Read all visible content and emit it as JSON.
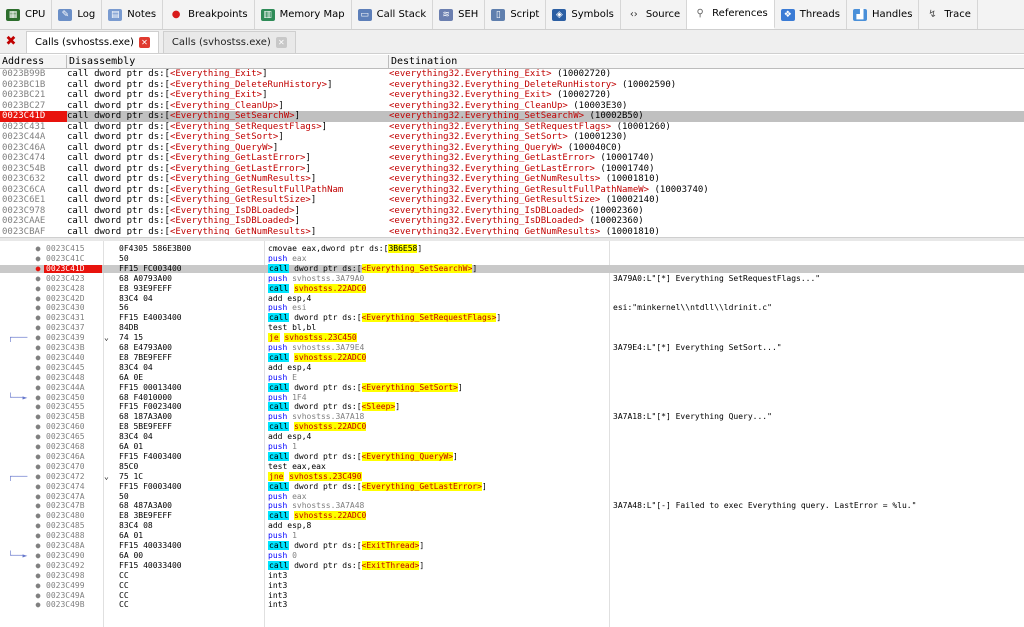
{
  "toolbar": {
    "tabs": [
      {
        "label": "CPU",
        "icon": "cpu-icon",
        "color": "#2d6e2d"
      },
      {
        "label": "Log",
        "icon": "log-icon",
        "color": "#6b8fc7"
      },
      {
        "label": "Notes",
        "icon": "notes-icon",
        "color": "#7a9bd0"
      },
      {
        "label": "Breakpoints",
        "icon": "breakpoint-icon",
        "color": "#d81b1b"
      },
      {
        "label": "Memory Map",
        "icon": "memory-map-icon",
        "color": "#2e8b57"
      },
      {
        "label": "Call Stack",
        "icon": "call-stack-icon",
        "color": "#5d7fb9"
      },
      {
        "label": "SEH",
        "icon": "seh-icon",
        "color": "#6b7fb0"
      },
      {
        "label": "Script",
        "icon": "script-icon",
        "color": "#5f7fae"
      },
      {
        "label": "Symbols",
        "icon": "symbols-icon",
        "color": "#2c5fa3"
      },
      {
        "label": "Source",
        "icon": "source-icon",
        "color": "#333333"
      },
      {
        "label": "References",
        "icon": "references-icon",
        "color": "#666666"
      },
      {
        "label": "Threads",
        "icon": "threads-icon",
        "color": "#3a7bd5"
      },
      {
        "label": "Handles",
        "icon": "handles-icon",
        "color": "#4a90d9"
      },
      {
        "label": "Trace",
        "icon": "trace-icon",
        "color": "#555555"
      }
    ]
  },
  "subtabs": [
    {
      "label": "Calls (svhostss.exe)",
      "active": true
    },
    {
      "label": "Calls (svhostss.exe)",
      "active": false
    }
  ],
  "references": {
    "headers": [
      "Address",
      "Disassembly",
      "Destination"
    ],
    "rows": [
      {
        "addr": "0023B99B",
        "dis": [
          "call dword ptr ds:[",
          "<Everything_Exit>",
          "]"
        ],
        "dest": [
          "<everything32.Everything_Exit>",
          " (10002720)"
        ]
      },
      {
        "addr": "0023BC1B",
        "dis": [
          "call dword ptr ds:[",
          "<Everything_DeleteRunHistory>",
          "]"
        ],
        "dest": [
          "<everything32.Everything_DeleteRunHistory>",
          " (10002590)"
        ]
      },
      {
        "addr": "0023BC21",
        "dis": [
          "call dword ptr ds:[",
          "<Everything_Exit>",
          "]"
        ],
        "dest": [
          "<everything32.Everything_Exit>",
          " (10002720)"
        ]
      },
      {
        "addr": "0023BC27",
        "dis": [
          "call dword ptr ds:[",
          "<Everything_CleanUp>",
          "]"
        ],
        "dest": [
          "<everything32.Everything_CleanUp>",
          " (10003E30)"
        ]
      },
      {
        "addr": "0023C41D",
        "dis": [
          "call dword ptr ds:[",
          "<Everything_SetSearchW>",
          "]"
        ],
        "dest": [
          "<everything32.Everything_SetSearchW>",
          " (10002B50)"
        ],
        "selected": true
      },
      {
        "addr": "0023C431",
        "dis": [
          "call dword ptr ds:[",
          "<Everything_SetRequestFlags>",
          "]"
        ],
        "dest": [
          "<everything32.Everything_SetRequestFlags>",
          " (10001260)"
        ]
      },
      {
        "addr": "0023C44A",
        "dis": [
          "call dword ptr ds:[",
          "<Everything_SetSort>",
          "]"
        ],
        "dest": [
          "<everything32.Everything_SetSort>",
          " (10001230)"
        ]
      },
      {
        "addr": "0023C46A",
        "dis": [
          "call dword ptr ds:[",
          "<Everything_QueryW>",
          "]"
        ],
        "dest": [
          "<everything32.Everything_QueryW>",
          " (100040C0)"
        ]
      },
      {
        "addr": "0023C474",
        "dis": [
          "call dword ptr ds:[",
          "<Everything_GetLastError>",
          "]"
        ],
        "dest": [
          "<everything32.Everything_GetLastError>",
          " (10001740)"
        ]
      },
      {
        "addr": "0023C54B",
        "dis": [
          "call dword ptr ds:[",
          "<Everything_GetLastError>",
          "]"
        ],
        "dest": [
          "<everything32.Everything_GetLastError>",
          " (10001740)"
        ]
      },
      {
        "addr": "0023C632",
        "dis": [
          "call dword ptr ds:[",
          "<Everything_GetNumResults>",
          "]"
        ],
        "dest": [
          "<everything32.Everything_GetNumResults>",
          " (10001810)"
        ]
      },
      {
        "addr": "0023C6CA",
        "dis": [
          "call dword ptr ds:[",
          "<Everything_GetResultFullPathNam",
          ""
        ],
        "dest": [
          "<everything32.Everything_GetResultFullPathNameW>",
          " (10003740)"
        ]
      },
      {
        "addr": "0023C6E1",
        "dis": [
          "call dword ptr ds:[",
          "<Everything_GetResultSize>",
          "]"
        ],
        "dest": [
          "<everything32.Everything_GetResultSize>",
          " (10002140)"
        ]
      },
      {
        "addr": "0023C978",
        "dis": [
          "call dword ptr ds:[",
          "<Everything_IsDBLoaded>",
          "]"
        ],
        "dest": [
          "<everything32.Everything_IsDBLoaded>",
          " (10002360)"
        ]
      },
      {
        "addr": "0023CAAE",
        "dis": [
          "call dword ptr ds:[",
          "<Everything_IsDBLoaded>",
          "]"
        ],
        "dest": [
          "<everything32.Everything_IsDBLoaded>",
          " (10002360)"
        ]
      },
      {
        "addr": "0023CBAF",
        "dis": [
          "call dword ptr ds:[",
          "<Everything_GetNumResults>",
          "]"
        ],
        "dest": [
          "<everything32.Everything_GetNumResults>",
          " (10001810)"
        ]
      },
      {
        "addr": "003D8CE9",
        "dis": [
          "mov al,byte ptr ds:[F899E5]",
          "",
          ""
        ],
        "dest": [
          "everything32.10000000",
          ""
        ]
      }
    ]
  },
  "disasm": [
    {
      "addr": "0023C415",
      "bytes": "0F4305 586E3B00",
      "mn": "cmovae",
      "kind": "plain",
      "ops": [
        [
          "blk",
          "eax,dword ptr ds:["
        ],
        [
          "addrhl",
          "3B6E58"
        ],
        [
          "blk",
          "]"
        ]
      ],
      "cmt": ""
    },
    {
      "addr": "0023C41C",
      "bytes": "50",
      "mn": "push",
      "kind": "push",
      "ops": [
        [
          "push",
          "eax"
        ]
      ],
      "cmt": ""
    },
    {
      "addr": "0023C41D",
      "bytes": "FF15 FC003400",
      "mn": "call",
      "kind": "call",
      "ops": [
        [
          "blk",
          "dword ptr ds:["
        ],
        [
          "symhl",
          "<Everything_SetSearchW>"
        ],
        [
          "blk",
          "]"
        ]
      ],
      "cmt": "",
      "current": true,
      "bp": true
    },
    {
      "addr": "0023C423",
      "bytes": "68 A0793A00",
      "mn": "push",
      "kind": "push",
      "ops": [
        [
          "push",
          "svhostss.3A79A0"
        ]
      ],
      "cmt": "3A79A0:L\"[*] Everything SetRequestFlags...\""
    },
    {
      "addr": "0023C428",
      "bytes": "E8 93E9FEFF",
      "mn": "call",
      "kind": "call",
      "ops": [
        [
          "symhl",
          "svhostss.22ADC0"
        ]
      ],
      "cmt": ""
    },
    {
      "addr": "0023C42D",
      "bytes": "83C4 04",
      "mn": "add",
      "kind": "plain",
      "ops": [
        [
          "blk",
          "esp,4"
        ]
      ],
      "cmt": ""
    },
    {
      "addr": "0023C430",
      "bytes": "56",
      "mn": "push",
      "kind": "push",
      "ops": [
        [
          "push",
          "esi"
        ]
      ],
      "cmt": "esi:\"minkernel\\\\ntdll\\\\ldrinit.c\""
    },
    {
      "addr": "0023C431",
      "bytes": "FF15 E4003400",
      "mn": "call",
      "kind": "call",
      "ops": [
        [
          "blk",
          "dword ptr ds:["
        ],
        [
          "symhl",
          "<Everything_SetRequestFlags>"
        ],
        [
          "blk",
          "]"
        ]
      ],
      "cmt": ""
    },
    {
      "addr": "0023C437",
      "bytes": "84DB",
      "mn": "test",
      "kind": "plain",
      "ops": [
        [
          "blk",
          "bl,bl"
        ]
      ],
      "cmt": ""
    },
    {
      "addr": "0023C439",
      "bytes": "74 15",
      "mn": "je",
      "kind": "jcc",
      "ops": [
        [
          "symhl",
          "svhostss.23C450"
        ]
      ],
      "cmt": "",
      "jmpmark": "v",
      "arrow": "start"
    },
    {
      "addr": "0023C43B",
      "bytes": "68 E4793A00",
      "mn": "push",
      "kind": "push",
      "ops": [
        [
          "push",
          "svhostss.3A79E4"
        ]
      ],
      "cmt": "3A79E4:L\"[*] Everything SetSort...\""
    },
    {
      "addr": "0023C440",
      "bytes": "E8 7BE9FEFF",
      "mn": "call",
      "kind": "call",
      "ops": [
        [
          "symhl",
          "svhostss.22ADC0"
        ]
      ],
      "cmt": ""
    },
    {
      "addr": "0023C445",
      "bytes": "83C4 04",
      "mn": "add",
      "kind": "plain",
      "ops": [
        [
          "blk",
          "esp,4"
        ]
      ],
      "cmt": ""
    },
    {
      "addr": "0023C448",
      "bytes": "6A 0E",
      "mn": "push",
      "kind": "push",
      "ops": [
        [
          "push",
          "E"
        ]
      ],
      "cmt": ""
    },
    {
      "addr": "0023C44A",
      "bytes": "FF15 00013400",
      "mn": "call",
      "kind": "call",
      "ops": [
        [
          "blk",
          "dword ptr ds:["
        ],
        [
          "symhl",
          "<Everything_SetSort>"
        ],
        [
          "blk",
          "]"
        ]
      ],
      "cmt": ""
    },
    {
      "addr": "0023C450",
      "bytes": "68 F4010000",
      "mn": "push",
      "kind": "push",
      "ops": [
        [
          "push",
          "1F4"
        ]
      ],
      "cmt": "",
      "arrow": "end"
    },
    {
      "addr": "0023C455",
      "bytes": "FF15 F0023400",
      "mn": "call",
      "kind": "call",
      "ops": [
        [
          "blk",
          "dword ptr ds:["
        ],
        [
          "symhl",
          "<Sleep>"
        ],
        [
          "blk",
          "]"
        ]
      ],
      "cmt": ""
    },
    {
      "addr": "0023C45B",
      "bytes": "68 187A3A00",
      "mn": "push",
      "kind": "push",
      "ops": [
        [
          "push",
          "svhostss.3A7A18"
        ]
      ],
      "cmt": "3A7A18:L\"[*] Everything Query...\""
    },
    {
      "addr": "0023C460",
      "bytes": "E8 5BE9FEFF",
      "mn": "call",
      "kind": "call",
      "ops": [
        [
          "symhl",
          "svhostss.22ADC0"
        ]
      ],
      "cmt": ""
    },
    {
      "addr": "0023C465",
      "bytes": "83C4 04",
      "mn": "add",
      "kind": "plain",
      "ops": [
        [
          "blk",
          "esp,4"
        ]
      ],
      "cmt": ""
    },
    {
      "addr": "0023C468",
      "bytes": "6A 01",
      "mn": "push",
      "kind": "push",
      "ops": [
        [
          "push",
          "1"
        ]
      ],
      "cmt": ""
    },
    {
      "addr": "0023C46A",
      "bytes": "FF15 F4003400",
      "mn": "call",
      "kind": "call",
      "ops": [
        [
          "blk",
          "dword ptr ds:["
        ],
        [
          "symhl",
          "<Everything_QueryW>"
        ],
        [
          "blk",
          "]"
        ]
      ],
      "cmt": ""
    },
    {
      "addr": "0023C470",
      "bytes": "85C0",
      "mn": "test",
      "kind": "plain",
      "ops": [
        [
          "blk",
          "eax,eax"
        ]
      ],
      "cmt": ""
    },
    {
      "addr": "0023C472",
      "bytes": "75 1C",
      "mn": "jne",
      "kind": "jcc",
      "ops": [
        [
          "symhl",
          "svhostss.23C490"
        ]
      ],
      "cmt": "",
      "jmpmark": "v",
      "arrow": "start"
    },
    {
      "addr": "0023C474",
      "bytes": "FF15 F0003400",
      "mn": "call",
      "kind": "call",
      "ops": [
        [
          "blk",
          "dword ptr ds:["
        ],
        [
          "symhl",
          "<Everything_GetLastError>"
        ],
        [
          "blk",
          "]"
        ]
      ],
      "cmt": ""
    },
    {
      "addr": "0023C47A",
      "bytes": "50",
      "mn": "push",
      "kind": "push",
      "ops": [
        [
          "push",
          "eax"
        ]
      ],
      "cmt": ""
    },
    {
      "addr": "0023C47B",
      "bytes": "68 487A3A00",
      "mn": "push",
      "kind": "push",
      "ops": [
        [
          "push",
          "svhostss.3A7A48"
        ]
      ],
      "cmt": "3A7A48:L\"[-] Failed to exec Everything query. LastError = %lu.\""
    },
    {
      "addr": "0023C480",
      "bytes": "E8 3BE9FEFF",
      "mn": "call",
      "kind": "call",
      "ops": [
        [
          "symhl",
          "svhostss.22ADC0"
        ]
      ],
      "cmt": ""
    },
    {
      "addr": "0023C485",
      "bytes": "83C4 08",
      "mn": "add",
      "kind": "plain",
      "ops": [
        [
          "blk",
          "esp,8"
        ]
      ],
      "cmt": ""
    },
    {
      "addr": "0023C488",
      "bytes": "6A 01",
      "mn": "push",
      "kind": "push",
      "ops": [
        [
          "push",
          "1"
        ]
      ],
      "cmt": ""
    },
    {
      "addr": "0023C48A",
      "bytes": "FF15 40033400",
      "mn": "call",
      "kind": "call",
      "ops": [
        [
          "blk",
          "dword ptr ds:["
        ],
        [
          "symhl",
          "<ExitThread>"
        ],
        [
          "blk",
          "]"
        ]
      ],
      "cmt": ""
    },
    {
      "addr": "0023C490",
      "bytes": "6A 00",
      "mn": "push",
      "kind": "push",
      "ops": [
        [
          "push",
          "0"
        ]
      ],
      "cmt": "",
      "arrow": "end"
    },
    {
      "addr": "0023C492",
      "bytes": "FF15 40033400",
      "mn": "call",
      "kind": "call",
      "ops": [
        [
          "blk",
          "dword ptr ds:["
        ],
        [
          "symhl",
          "<ExitThread>"
        ],
        [
          "blk",
          "]"
        ]
      ],
      "cmt": ""
    },
    {
      "addr": "0023C498",
      "bytes": "CC",
      "mn": "int3",
      "kind": "plain",
      "ops": [],
      "cmt": ""
    },
    {
      "addr": "0023C499",
      "bytes": "CC",
      "mn": "int3",
      "kind": "plain",
      "ops": [],
      "cmt": ""
    },
    {
      "addr": "0023C49A",
      "bytes": "CC",
      "mn": "int3",
      "kind": "plain",
      "ops": [],
      "cmt": ""
    },
    {
      "addr": "0023C49B",
      "bytes": "CC",
      "mn": "int3",
      "kind": "plain",
      "ops": [],
      "cmt": ""
    }
  ]
}
